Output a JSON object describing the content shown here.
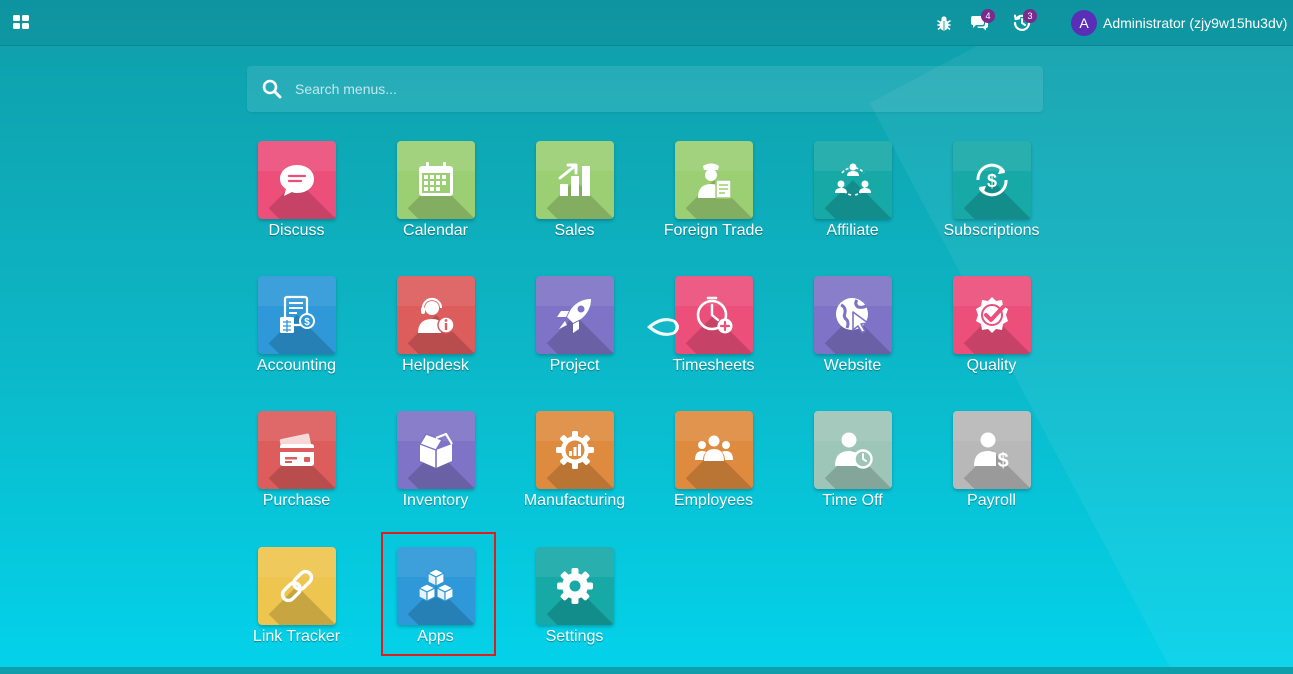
{
  "navbar": {
    "apps_icon": "grid-icon",
    "debug_icon": "bug-icon",
    "messages_icon": "chat-icon",
    "messages_count": "4",
    "activities_icon": "clock-icon",
    "activities_count": "3",
    "user_initial": "A",
    "user_name": "Administrator (zjy9w15hu3dv)"
  },
  "search": {
    "placeholder": "Search menus..."
  },
  "apps": [
    {
      "label": "Discuss",
      "color": "#ec4f7a",
      "icon": "chat-bubble-icon"
    },
    {
      "label": "Calendar",
      "color": "#9ccf74",
      "icon": "calendar-icon"
    },
    {
      "label": "Sales",
      "color": "#9ccf74",
      "icon": "chart-growth-icon"
    },
    {
      "label": "Foreign Trade",
      "color": "#9ccf74",
      "icon": "customs-officer-icon"
    },
    {
      "label": "Affiliate",
      "color": "#17a9a6",
      "icon": "network-people-icon"
    },
    {
      "label": "Subscriptions",
      "color": "#17a9a6",
      "icon": "recurring-dollar-icon"
    },
    {
      "label": "Accounting",
      "color": "#2e98d8",
      "icon": "invoice-calculator-icon"
    },
    {
      "label": "Helpdesk",
      "color": "#dd5c5c",
      "icon": "support-agent-icon"
    },
    {
      "label": "Project",
      "color": "#7e73c6",
      "icon": "rocket-icon"
    },
    {
      "label": "Timesheets",
      "color": "#ec4f7a",
      "icon": "timer-add-icon"
    },
    {
      "label": "Website",
      "color": "#7e73c6",
      "icon": "globe-cursor-icon"
    },
    {
      "label": "Quality",
      "color": "#ec4f7a",
      "icon": "quality-badge-icon"
    },
    {
      "label": "Purchase",
      "color": "#dd5c5c",
      "icon": "credit-card-icon"
    },
    {
      "label": "Inventory",
      "color": "#7e73c6",
      "icon": "box-icon"
    },
    {
      "label": "Manufacturing",
      "color": "#de8b3f",
      "icon": "gear-chart-icon"
    },
    {
      "label": "Employees",
      "color": "#de8b3f",
      "icon": "users-group-icon"
    },
    {
      "label": "Time Off",
      "color": "#9ec6b8",
      "icon": "user-clock-icon"
    },
    {
      "label": "Payroll",
      "color": "#b8b8b8",
      "icon": "user-dollar-icon"
    },
    {
      "label": "Link Tracker",
      "color": "#eec54e",
      "icon": "link-icon"
    },
    {
      "label": "Apps",
      "color": "#2e98d8",
      "icon": "cubes-icon"
    },
    {
      "label": "Settings",
      "color": "#17a9a6",
      "icon": "gear-icon"
    }
  ]
}
